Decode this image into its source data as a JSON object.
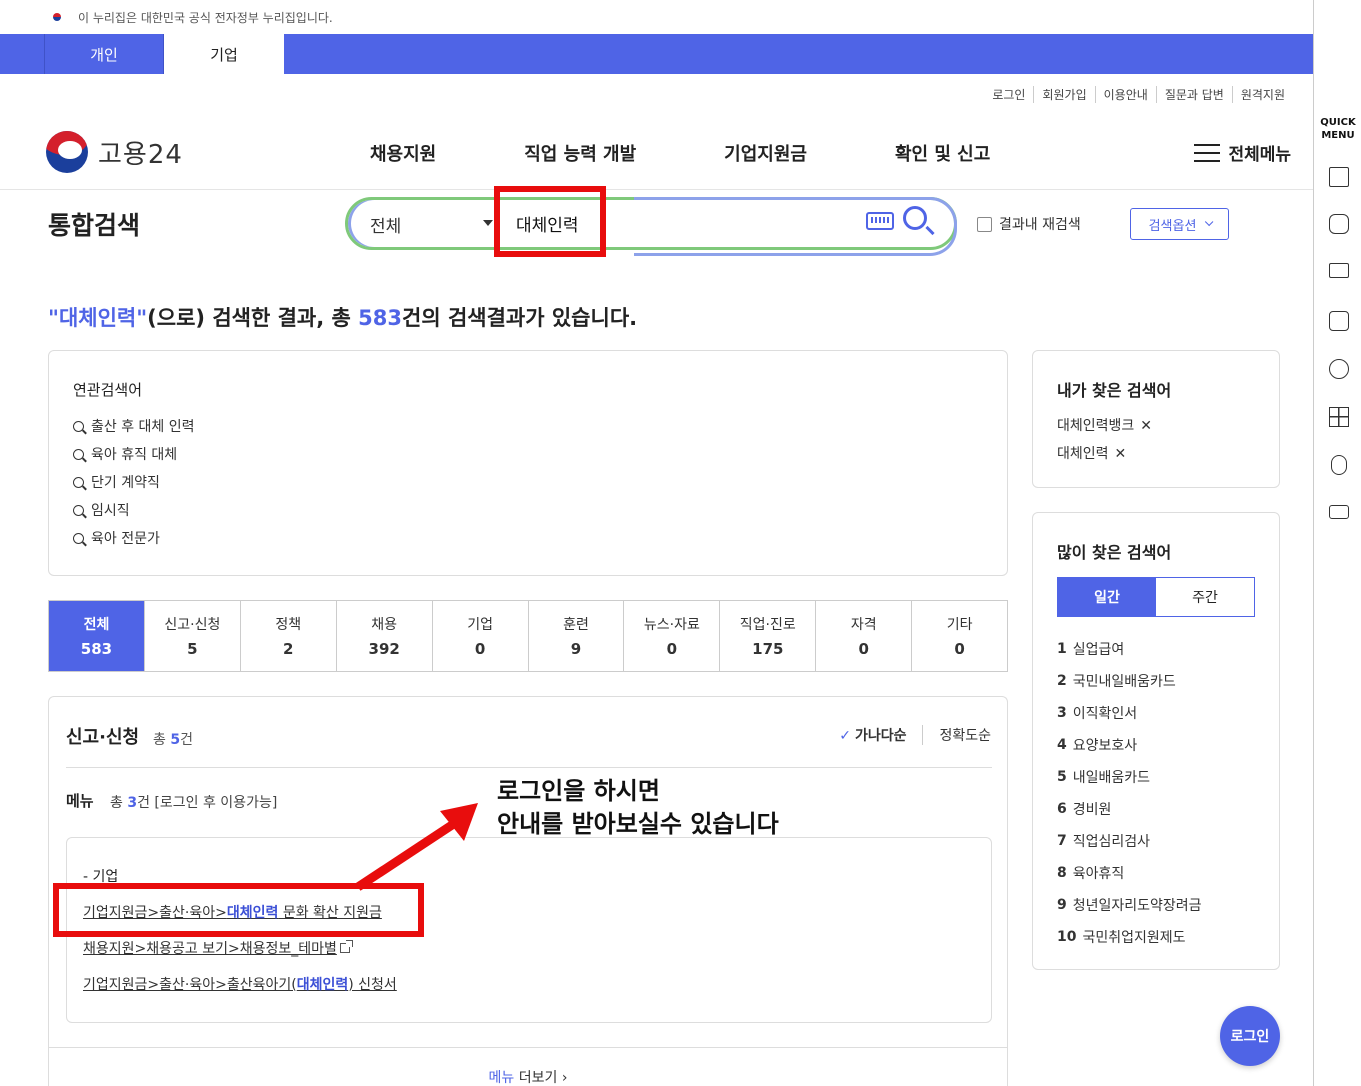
{
  "gov_banner": "이 누리집은 대한민국 공식 전자정부 누리집입니다.",
  "top_tabs": {
    "personal": "개인",
    "business": "기업"
  },
  "util_links": [
    "로그인",
    "회원가입",
    "이용안내",
    "질문과 답변",
    "원격지원"
  ],
  "logo_text": "고용24",
  "gnb": [
    "채용지원",
    "직업 능력 개발",
    "기업지원금",
    "확인 및 신고"
  ],
  "all_menu": "전체메뉴",
  "search": {
    "title": "통합검색",
    "scope": "전체",
    "query": "대체인력",
    "research_label": "결과내 재검색",
    "options_label": "검색옵션"
  },
  "headline": {
    "q": "\"대체인력\"",
    "part1": "(으로) 검색한 결과, 총 ",
    "count": "583",
    "part2": "건의 검색결과가 있습니다."
  },
  "related": {
    "title": "연관검색어",
    "items": [
      "출산 후 대체 인력",
      "육아 휴직 대체",
      "단기 계약직",
      "임시직",
      "육아 전문가"
    ]
  },
  "categories": [
    {
      "label": "전체",
      "count": "583"
    },
    {
      "label": "신고·신청",
      "count": "5"
    },
    {
      "label": "정책",
      "count": "2"
    },
    {
      "label": "채용",
      "count": "392"
    },
    {
      "label": "기업",
      "count": "0"
    },
    {
      "label": "훈련",
      "count": "9"
    },
    {
      "label": "뉴스·자료",
      "count": "0"
    },
    {
      "label": "직업·진로",
      "count": "175"
    },
    {
      "label": "자격",
      "count": "0"
    },
    {
      "label": "기타",
      "count": "0"
    }
  ],
  "report": {
    "title": "신고·신청",
    "total_pre": "총 ",
    "total_n": "5",
    "total_post": "건",
    "sort_on": "가나다순",
    "sort_off": "정확도순",
    "menu_label": "메뉴",
    "menu_count_pre": "총 ",
    "menu_count_n": "3",
    "menu_count_post": "건 [로그인 후 이용가능]",
    "group": "- 기업",
    "links": [
      {
        "pre": "기업지원금>출산·육아>",
        "hl": "대체인력",
        "post": " 문화 확산 지원금"
      },
      {
        "pre": "채용지원>채용공고 보기>채용정보_테마별",
        "hl": "",
        "post": ""
      },
      {
        "pre": "기업지원금>출산·육아>출산육아기(",
        "hl": "대체인력",
        "post": ") 신청서"
      }
    ],
    "more_a": "메뉴",
    "more_b": " 더보기",
    "more_arrow": "›"
  },
  "annotation": {
    "line1": "로그인을 하시면",
    "line2": "안내를 받아보실수 있습니다"
  },
  "my_searches": {
    "title": "내가 찾은 검색어",
    "items": [
      "대체인력뱅크",
      "대체인력"
    ],
    "remove_glyph": "✕"
  },
  "popular": {
    "title": "많이 찾은 검색어",
    "tab_daily": "일간",
    "tab_weekly": "주간",
    "items": [
      "실업급여",
      "국민내일배움카드",
      "이직확인서",
      "요양보호사",
      "내일배움카드",
      "경비원",
      "직업심리검사",
      "육아휴직",
      "청년일자리도약장려금",
      "국민취업지원제도"
    ]
  },
  "login_fab": "로그인",
  "quick_menu": {
    "line1": "QUICK",
    "line2": "MENU"
  },
  "colors": {
    "accent": "#4f64e6",
    "annotation_red": "#e80d0d"
  }
}
